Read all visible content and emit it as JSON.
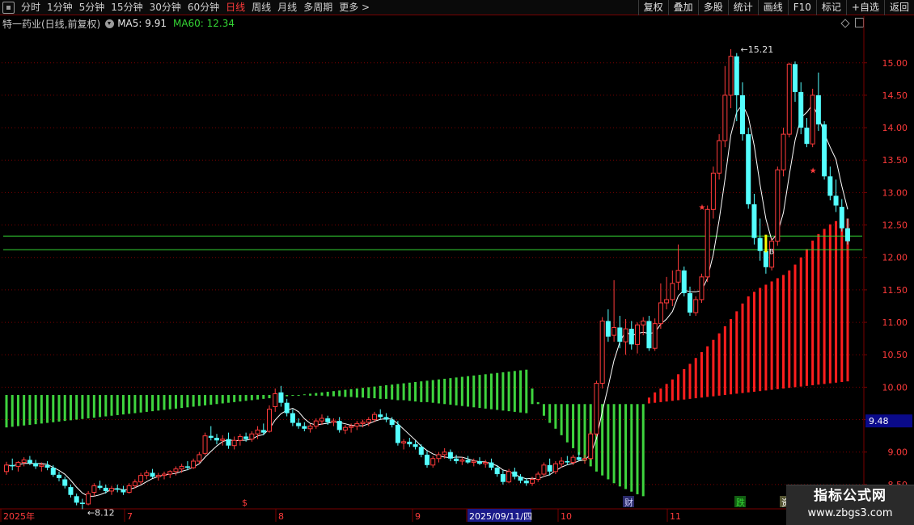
{
  "toolbar": {
    "periods": [
      "分时",
      "1分钟",
      "5分钟",
      "15分钟",
      "30分钟",
      "60分钟",
      "日线",
      "周线",
      "月线",
      "多周期",
      "更多 >"
    ],
    "active_period": "日线",
    "right_buttons": [
      "复权",
      "叠加",
      "多股",
      "统计",
      "画线",
      "F10",
      "标记",
      "+自选",
      "返回"
    ]
  },
  "info": {
    "title": "特一药业(日线,前复权)",
    "ma5": "MA5: 9.91",
    "ma60": "MA60: 12.34"
  },
  "colors": {
    "up": "#ff3b3b",
    "down": "#54ffff",
    "ma5": "#ffffff",
    "ma60": "#34d634",
    "green_bars": "#3ed43e",
    "red_bars": "#ff1e1e",
    "grid": "#7a0000"
  },
  "chart_data": {
    "type": "candlestick",
    "y_ticks": [
      "15.00",
      "14.50",
      "14.00",
      "13.50",
      "13.00",
      "12.50",
      "12.00",
      "11.50",
      "11.00",
      "10.50",
      "10.00",
      "9.50",
      "9.00",
      "8.50"
    ],
    "ylim": [
      8.15,
      15.47
    ],
    "x_labels": [
      "2025年",
      "7",
      "8",
      "9",
      "2025/09/11/四",
      "10",
      "11"
    ],
    "price_flag": "9.48",
    "annotations": {
      "high": "15.21",
      "low": "8.12"
    },
    "event_markers": [
      "$",
      "财",
      "跌",
      "资"
    ],
    "horizontal_lines": [
      12.33,
      12.12
    ],
    "candles": [
      [
        8.7,
        8.85,
        8.65,
        8.8
      ],
      [
        8.8,
        8.9,
        8.72,
        8.78
      ],
      [
        8.78,
        8.86,
        8.7,
        8.84
      ],
      [
        8.84,
        8.92,
        8.78,
        8.88
      ],
      [
        8.88,
        8.94,
        8.8,
        8.83
      ],
      [
        8.83,
        8.88,
        8.74,
        8.78
      ],
      [
        8.78,
        8.84,
        8.7,
        8.8
      ],
      [
        8.8,
        8.86,
        8.72,
        8.76
      ],
      [
        8.76,
        8.8,
        8.62,
        8.65
      ],
      [
        8.65,
        8.7,
        8.55,
        8.6
      ],
      [
        8.58,
        8.62,
        8.44,
        8.48
      ],
      [
        8.46,
        8.5,
        8.3,
        8.34
      ],
      [
        8.32,
        8.36,
        8.18,
        8.22
      ],
      [
        8.22,
        8.28,
        8.12,
        8.2
      ],
      [
        8.2,
        8.4,
        8.18,
        8.36
      ],
      [
        8.38,
        8.52,
        8.32,
        8.48
      ],
      [
        8.48,
        8.56,
        8.42,
        8.45
      ],
      [
        8.45,
        8.5,
        8.36,
        8.4
      ],
      [
        8.4,
        8.48,
        8.34,
        8.44
      ],
      [
        8.44,
        8.5,
        8.38,
        8.42
      ],
      [
        8.42,
        8.48,
        8.34,
        8.38
      ],
      [
        8.38,
        8.52,
        8.36,
        8.48
      ],
      [
        8.48,
        8.58,
        8.44,
        8.54
      ],
      [
        8.54,
        8.68,
        8.5,
        8.64
      ],
      [
        8.64,
        8.72,
        8.58,
        8.68
      ],
      [
        8.68,
        8.74,
        8.6,
        8.62
      ],
      [
        8.62,
        8.68,
        8.56,
        8.64
      ],
      [
        8.64,
        8.7,
        8.58,
        8.66
      ],
      [
        8.66,
        8.72,
        8.6,
        8.7
      ],
      [
        8.7,
        8.78,
        8.64,
        8.74
      ],
      [
        8.74,
        8.82,
        8.68,
        8.78
      ],
      [
        8.78,
        8.86,
        8.72,
        8.76
      ],
      [
        8.76,
        8.9,
        8.74,
        8.86
      ],
      [
        8.86,
        9.0,
        8.82,
        8.96
      ],
      [
        8.98,
        9.3,
        8.95,
        9.25
      ],
      [
        9.25,
        9.4,
        9.18,
        9.22
      ],
      [
        9.22,
        9.28,
        9.12,
        9.18
      ],
      [
        9.18,
        9.26,
        9.1,
        9.2
      ],
      [
        9.2,
        9.3,
        9.05,
        9.1
      ],
      [
        9.1,
        9.24,
        9.04,
        9.18
      ],
      [
        9.18,
        9.28,
        9.1,
        9.24
      ],
      [
        9.24,
        9.3,
        9.16,
        9.2
      ],
      [
        9.2,
        9.32,
        9.16,
        9.28
      ],
      [
        9.28,
        9.4,
        9.2,
        9.34
      ],
      [
        9.34,
        9.44,
        9.26,
        9.3
      ],
      [
        9.32,
        9.72,
        9.3,
        9.66
      ],
      [
        9.7,
        9.98,
        9.62,
        9.9
      ],
      [
        9.92,
        10.02,
        9.7,
        9.76
      ],
      [
        9.76,
        9.82,
        9.55,
        9.6
      ],
      [
        9.6,
        9.66,
        9.4,
        9.45
      ],
      [
        9.45,
        9.52,
        9.36,
        9.4
      ],
      [
        9.4,
        9.46,
        9.32,
        9.36
      ],
      [
        9.36,
        9.44,
        9.3,
        9.4
      ],
      [
        9.4,
        9.52,
        9.36,
        9.48
      ],
      [
        9.48,
        9.58,
        9.42,
        9.52
      ],
      [
        9.52,
        9.56,
        9.42,
        9.46
      ],
      [
        9.46,
        9.52,
        9.4,
        9.48
      ],
      [
        9.48,
        9.54,
        9.3,
        9.34
      ],
      [
        9.34,
        9.42,
        9.28,
        9.38
      ],
      [
        9.38,
        9.44,
        9.3,
        9.4
      ],
      [
        9.4,
        9.48,
        9.34,
        9.44
      ],
      [
        9.44,
        9.5,
        9.38,
        9.46
      ],
      [
        9.46,
        9.54,
        9.4,
        9.5
      ],
      [
        9.5,
        9.62,
        9.46,
        9.58
      ],
      [
        9.58,
        9.66,
        9.5,
        9.54
      ],
      [
        9.54,
        9.6,
        9.46,
        9.5
      ],
      [
        9.5,
        9.54,
        9.38,
        9.42
      ],
      [
        9.42,
        9.48,
        9.1,
        9.14
      ],
      [
        9.14,
        9.2,
        9.04,
        9.16
      ],
      [
        9.16,
        9.22,
        9.08,
        9.12
      ],
      [
        9.12,
        9.18,
        9.04,
        9.08
      ],
      [
        9.08,
        9.12,
        8.92,
        8.96
      ],
      [
        8.96,
        9.02,
        8.76,
        8.8
      ],
      [
        8.8,
        8.94,
        8.76,
        8.9
      ],
      [
        8.9,
        9.0,
        8.84,
        8.96
      ],
      [
        8.96,
        9.06,
        8.9,
        9.0
      ],
      [
        9.0,
        9.04,
        8.86,
        8.9
      ],
      [
        8.9,
        8.96,
        8.82,
        8.86
      ],
      [
        8.86,
        8.92,
        8.8,
        8.88
      ],
      [
        8.88,
        8.94,
        8.82,
        8.84
      ],
      [
        8.84,
        8.9,
        8.78,
        8.86
      ],
      [
        8.86,
        8.92,
        8.8,
        8.82
      ],
      [
        8.82,
        8.88,
        8.76,
        8.84
      ],
      [
        8.84,
        8.9,
        8.72,
        8.76
      ],
      [
        8.76,
        8.8,
        8.62,
        8.66
      ],
      [
        8.66,
        8.72,
        8.5,
        8.54
      ],
      [
        8.54,
        8.74,
        8.52,
        8.7
      ],
      [
        8.7,
        8.76,
        8.58,
        8.62
      ],
      [
        8.62,
        8.66,
        8.52,
        8.56
      ],
      [
        8.56,
        8.6,
        8.48,
        8.52
      ],
      [
        8.52,
        8.62,
        8.48,
        8.58
      ],
      [
        8.58,
        8.7,
        8.54,
        8.66
      ],
      [
        8.66,
        8.84,
        8.62,
        8.8
      ],
      [
        8.8,
        8.9,
        8.64,
        8.7
      ],
      [
        8.7,
        8.86,
        8.66,
        8.82
      ],
      [
        8.82,
        8.92,
        8.76,
        8.86
      ],
      [
        8.86,
        8.94,
        8.8,
        8.84
      ],
      [
        8.84,
        8.96,
        8.8,
        8.92
      ],
      [
        8.92,
        9.0,
        8.86,
        8.88
      ],
      [
        8.88,
        8.96,
        8.82,
        8.9
      ],
      [
        8.9,
        9.32,
        8.88,
        9.28
      ],
      [
        9.28,
        10.1,
        9.24,
        10.06
      ],
      [
        10.06,
        11.08,
        9.98,
        11.02
      ],
      [
        11.02,
        11.2,
        10.7,
        10.78
      ],
      [
        10.8,
        11.65,
        10.7,
        10.92
      ],
      [
        10.92,
        11.1,
        10.6,
        10.7
      ],
      [
        10.7,
        11.05,
        10.5,
        10.9
      ],
      [
        10.9,
        11.02,
        10.58,
        10.66
      ],
      [
        10.66,
        11.0,
        10.52,
        10.96
      ],
      [
        10.96,
        11.08,
        10.8,
        11.02
      ],
      [
        11.02,
        11.1,
        10.56,
        10.6
      ],
      [
        10.6,
        11.06,
        10.56,
        10.98
      ],
      [
        10.98,
        11.6,
        10.9,
        11.3
      ],
      [
        11.3,
        11.7,
        11.2,
        11.35
      ],
      [
        11.35,
        11.8,
        11.25,
        11.6
      ],
      [
        11.62,
        12.2,
        11.5,
        11.8
      ],
      [
        11.8,
        11.86,
        11.4,
        11.45
      ],
      [
        11.45,
        11.55,
        11.1,
        11.15
      ],
      [
        11.15,
        11.4,
        11.1,
        11.35
      ],
      [
        11.35,
        11.75,
        11.3,
        11.7
      ],
      [
        11.7,
        12.8,
        11.62,
        12.74
      ],
      [
        12.74,
        13.4,
        12.6,
        13.3
      ],
      [
        13.3,
        13.9,
        13.2,
        13.8
      ],
      [
        13.8,
        14.95,
        13.7,
        14.5
      ],
      [
        14.5,
        15.21,
        14.3,
        15.1
      ],
      [
        15.1,
        15.15,
        14.1,
        14.5
      ],
      [
        14.5,
        14.7,
        13.8,
        13.9
      ],
      [
        13.9,
        14.0,
        12.75,
        12.82
      ],
      [
        12.82,
        12.98,
        12.2,
        12.3
      ],
      [
        12.3,
        12.6,
        11.95,
        12.1
      ],
      [
        12.1,
        12.2,
        11.75,
        11.85
      ],
      [
        11.85,
        12.3,
        11.8,
        12.25
      ],
      [
        12.25,
        13.4,
        12.18,
        13.35
      ],
      [
        13.35,
        14.0,
        13.25,
        13.9
      ],
      [
        13.9,
        15.0,
        13.85,
        14.98
      ],
      [
        14.98,
        15.02,
        14.4,
        14.55
      ],
      [
        14.55,
        14.7,
        13.9,
        14.0
      ],
      [
        14.0,
        14.15,
        13.7,
        13.75
      ],
      [
        13.75,
        14.6,
        13.7,
        14.5
      ],
      [
        14.5,
        14.85,
        13.95,
        14.05
      ],
      [
        14.05,
        14.1,
        13.2,
        13.25
      ],
      [
        13.25,
        13.4,
        12.88,
        12.95
      ],
      [
        12.95,
        13.2,
        12.7,
        12.8
      ],
      [
        12.78,
        12.9,
        12.4,
        12.45
      ],
      [
        12.45,
        12.6,
        12.2,
        12.25
      ]
    ],
    "indicator_bars": [
      [
        9.88,
        9.38
      ],
      [
        9.88,
        9.39
      ],
      [
        9.88,
        9.4
      ],
      [
        9.88,
        9.41
      ],
      [
        9.88,
        9.42
      ],
      [
        9.88,
        9.43
      ],
      [
        9.88,
        9.44
      ],
      [
        9.88,
        9.45
      ],
      [
        9.88,
        9.46
      ],
      [
        9.88,
        9.47
      ],
      [
        9.88,
        9.48
      ],
      [
        9.88,
        9.49
      ],
      [
        9.88,
        9.5
      ],
      [
        9.88,
        9.51
      ],
      [
        9.88,
        9.52
      ],
      [
        9.88,
        9.53
      ],
      [
        9.88,
        9.54
      ],
      [
        9.88,
        9.55
      ],
      [
        9.88,
        9.56
      ],
      [
        9.88,
        9.57
      ],
      [
        9.88,
        9.58
      ],
      [
        9.88,
        9.59
      ],
      [
        9.88,
        9.6
      ],
      [
        9.88,
        9.61
      ],
      [
        9.88,
        9.62
      ],
      [
        9.88,
        9.63
      ],
      [
        9.88,
        9.64
      ],
      [
        9.88,
        9.65
      ],
      [
        9.88,
        9.66
      ],
      [
        9.88,
        9.67
      ],
      [
        9.88,
        9.68
      ],
      [
        9.88,
        9.69
      ],
      [
        9.88,
        9.7
      ],
      [
        9.88,
        9.71
      ],
      [
        9.88,
        9.72
      ],
      [
        9.88,
        9.73
      ],
      [
        9.88,
        9.74
      ],
      [
        9.88,
        9.75
      ],
      [
        9.88,
        9.76
      ],
      [
        9.88,
        9.77
      ],
      [
        9.88,
        9.78
      ],
      [
        9.88,
        9.79
      ],
      [
        9.88,
        9.8
      ],
      [
        9.88,
        9.81
      ],
      [
        9.88,
        9.82
      ],
      [
        9.88,
        9.83
      ],
      [
        9.88,
        9.84
      ],
      [
        9.88,
        9.85
      ],
      [
        9.88,
        9.86
      ],
      [
        9.88,
        9.87
      ],
      [
        9.88,
        9.88
      ],
      [
        9.88,
        9.89
      ],
      [
        9.87,
        9.9
      ],
      [
        9.87,
        9.91
      ],
      [
        9.87,
        9.92
      ],
      [
        9.86,
        9.93
      ],
      [
        9.86,
        9.94
      ],
      [
        9.86,
        9.95
      ],
      [
        9.85,
        9.96
      ],
      [
        9.85,
        9.97
      ],
      [
        9.84,
        9.98
      ],
      [
        9.84,
        9.99
      ],
      [
        9.83,
        10.0
      ],
      [
        9.83,
        10.01
      ],
      [
        9.82,
        10.02
      ],
      [
        9.82,
        10.03
      ],
      [
        9.81,
        10.04
      ],
      [
        9.8,
        10.05
      ],
      [
        9.8,
        10.06
      ],
      [
        9.79,
        10.07
      ],
      [
        9.78,
        10.08
      ],
      [
        9.77,
        10.09
      ],
      [
        9.77,
        10.1
      ],
      [
        9.76,
        10.11
      ],
      [
        9.75,
        10.12
      ],
      [
        9.74,
        10.13
      ],
      [
        9.73,
        10.14
      ],
      [
        9.72,
        10.15
      ],
      [
        9.71,
        10.16
      ],
      [
        9.7,
        10.17
      ],
      [
        9.69,
        10.18
      ],
      [
        9.68,
        10.19
      ],
      [
        9.67,
        10.2
      ],
      [
        9.66,
        10.21
      ],
      [
        9.65,
        10.22
      ],
      [
        9.64,
        10.23
      ],
      [
        9.63,
        10.24
      ],
      [
        9.62,
        10.25
      ],
      [
        9.61,
        10.26
      ],
      [
        9.6,
        10.27
      ],
      [
        9.74,
        9.98
      ],
      [
        9.74,
        9.77
      ],
      [
        9.74,
        9.56
      ],
      [
        9.74,
        9.45
      ],
      [
        9.74,
        9.36
      ],
      [
        9.74,
        9.26
      ],
      [
        9.74,
        9.15
      ],
      [
        9.74,
        9.06
      ],
      [
        9.74,
        8.96
      ],
      [
        9.74,
        8.86
      ],
      [
        9.74,
        8.78
      ],
      [
        9.74,
        8.7
      ],
      [
        9.74,
        8.64
      ],
      [
        9.74,
        8.58
      ],
      [
        9.74,
        8.52
      ],
      [
        9.74,
        8.47
      ],
      [
        9.74,
        8.43
      ],
      [
        9.74,
        8.39
      ],
      [
        9.74,
        8.35
      ],
      [
        9.74,
        8.32
      ],
      [
        9.75,
        9.84
      ],
      [
        9.76,
        9.92
      ],
      [
        9.77,
        9.98
      ],
      [
        9.78,
        10.05
      ],
      [
        9.79,
        10.12
      ],
      [
        9.8,
        10.2
      ],
      [
        9.81,
        10.28
      ],
      [
        9.82,
        10.36
      ],
      [
        9.83,
        10.45
      ],
      [
        9.84,
        10.54
      ],
      [
        9.85,
        10.63
      ],
      [
        9.86,
        10.73
      ],
      [
        9.87,
        10.83
      ],
      [
        9.88,
        10.94
      ],
      [
        9.89,
        11.05
      ],
      [
        9.9,
        11.17
      ],
      [
        9.91,
        11.29
      ],
      [
        9.92,
        11.4
      ],
      [
        9.93,
        11.47
      ],
      [
        9.94,
        11.53
      ],
      [
        9.95,
        11.58
      ],
      [
        9.96,
        11.63
      ],
      [
        9.97,
        11.68
      ],
      [
        9.98,
        11.73
      ],
      [
        9.99,
        11.8
      ],
      [
        10.0,
        11.89
      ],
      [
        10.01,
        12.0
      ],
      [
        10.02,
        12.13
      ],
      [
        10.03,
        12.26
      ],
      [
        10.04,
        12.36
      ],
      [
        10.05,
        12.44
      ],
      [
        10.06,
        12.51
      ],
      [
        10.07,
        12.56
      ],
      [
        10.08,
        12.59
      ],
      [
        10.09,
        12.6
      ]
    ]
  }
}
